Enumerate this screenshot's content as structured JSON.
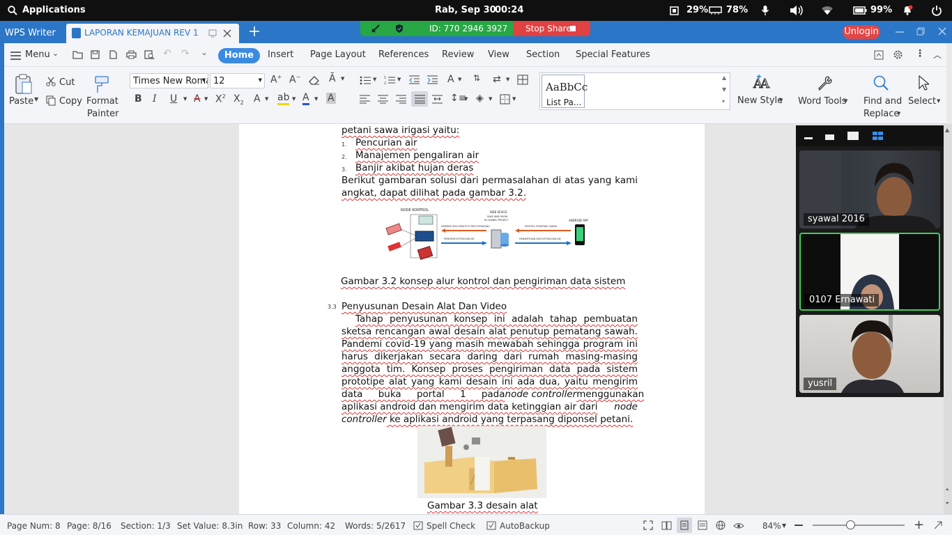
{
  "system_bar": {
    "applications": "Applications",
    "datetime": "Rab, Sep 30",
    "time": "00:24",
    "cpu": "29%",
    "memory": "78%",
    "battery": "99%"
  },
  "titlebar": {
    "app_name": "WPS Writer",
    "doc_tab": "LAPORAN KEMAJUAN REV 1",
    "meeting_id": "ID: 770 2946 3927",
    "stop_share": "Stop Share",
    "unlogin": "Unlogin"
  },
  "menu": {
    "menu_label": "Menu",
    "tabs": [
      "Home",
      "Insert",
      "Page Layout",
      "References",
      "Review",
      "View",
      "Section",
      "Special Features"
    ]
  },
  "toolbar": {
    "paste": "Paste",
    "cut": "Cut",
    "copy": "Copy",
    "format_painter_1": "Format",
    "format_painter_2": "Painter",
    "font_name": "Times New Roma",
    "font_size": "12",
    "style_preview": "AaBbCc",
    "style_name": "List Pa...",
    "new_style": "New Style",
    "word_tools": "Word Tools",
    "find_replace_1": "Find and",
    "find_replace_2": "Replace",
    "select": "Select"
  },
  "document": {
    "l1": "petani sawa irigasi yaitu:",
    "list": [
      {
        "num": "1.",
        "text": "Pencurian air"
      },
      {
        "num": "2.",
        "text": "Manajemen pengaliran air"
      },
      {
        "num": "3.",
        "text": "Banjir akibat hujan deras"
      }
    ],
    "p1a": "Berikut gambaran solusi dari permasalahan di atas yang kami",
    "p1b": "angkat, dapat dilihat pada gambar 3.2.",
    "caption1": "Gambar 3.2 konsep alur kontrol dan pengiriman data sistem",
    "sec_num": "3.3",
    "sec_title": "Penyusunan Desain Alat Dan Video",
    "p2": [
      "Tahap penyusunan konsep ini adalah tahap pembuatan",
      "sketsa rencangan awal desain alat penutup pematang sawah.",
      "Pandemi covid-19 yang masih mewabah sehingga program ini",
      "harus dikerjakan secara daring dari rumah masing-masing",
      "anggota tim. Konsep proses pengiriman data pada sistem",
      "prototipe alat yang kami desain ini ada dua, yaitu mengirim"
    ],
    "p2_l7a": "data buka portal 1 pada ",
    "p2_l7b": "node controller",
    "p2_l7c": " menggunakan",
    "p2_l8a": "aplikasi android dan mengirim data ketinggian air dari ",
    "p2_l8b": "node",
    "p2_l9a": "controller",
    "p2_l9b": " ke aplikasi android yang terpasang diponsel petani.",
    "caption2": "Gambar 3.3 desain alat",
    "diagram": {
      "node_kontrol": "NODE KONTROL",
      "web_service_1": "WEB SEVICE",
      "web_service_2": "SAVE AND SHOW",
      "web_service_3": "IN CHANEL PROJECT",
      "android_app": "ANDROID APP",
      "arrow1": "MEMBERI ATAU MENUTUP PINTU PEMATANG",
      "arrow2": "MENGIRIM KETINGGIAN AIR",
      "arrow3": "KONTROL PEMATANG SAWAH",
      "arrow4": "MENAMPILKAN DATA KETINGGIAN AIR"
    }
  },
  "video": {
    "participants": [
      "syawal 2016",
      "0107 Ernawati",
      "yusril"
    ]
  },
  "statusbar": {
    "page_num": "Page Num: 8",
    "page": "Page: 8/16",
    "section": "Section: 1/3",
    "set_value": "Set Value: 8.3in",
    "row": "Row: 33",
    "column": "Column: 42",
    "words": "Words: 5/2617",
    "spell_check": "Spell Check",
    "autobackup": "AutoBackup",
    "zoom": "84%"
  },
  "colors": {
    "wps_blue": "#2b76c6",
    "share_green": "#28a745",
    "share_red": "#e14141",
    "active_speaker": "#3fd15a"
  }
}
